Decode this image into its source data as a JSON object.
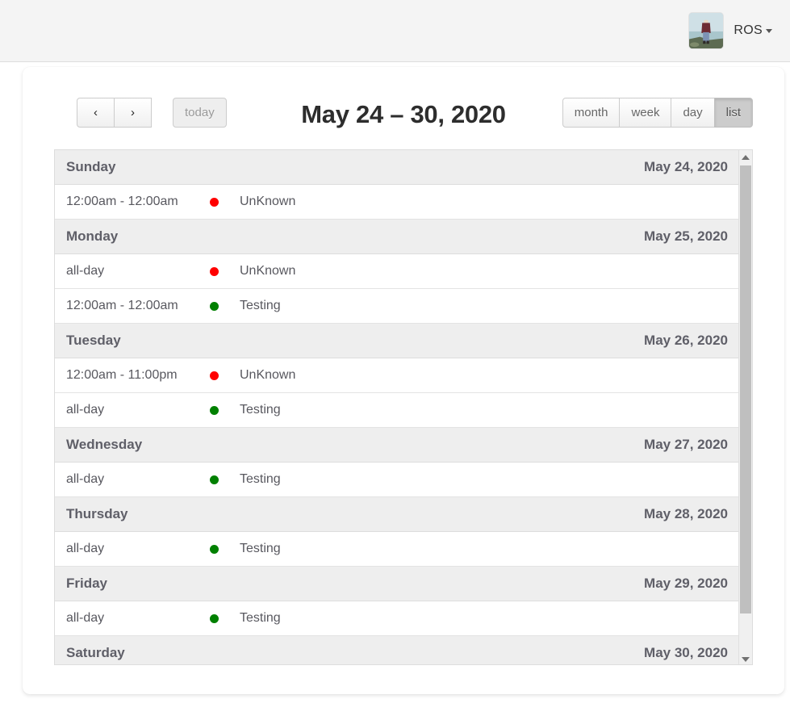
{
  "appbar": {
    "user_name": "ROS",
    "avatar_alt": "user-avatar",
    "caret": "chevron-down-icon"
  },
  "toolbar": {
    "prev_label": "‹",
    "next_label": "›",
    "today_label": "today",
    "title": "May 24 – 30, 2020",
    "views": [
      {
        "key": "month",
        "label": "month",
        "active": false
      },
      {
        "key": "week",
        "label": "week",
        "active": false
      },
      {
        "key": "day",
        "label": "day",
        "active": false
      },
      {
        "key": "list",
        "label": "list",
        "active": true
      }
    ]
  },
  "colors": {
    "event_unknown": "#ff0000",
    "event_testing": "#008000",
    "active_view_bg": "#cccccc",
    "day_header_bg": "#eeeeee",
    "page_bg": "#ffffff",
    "appbar_bg": "#f4f4f4"
  },
  "list": {
    "days": [
      {
        "dow": "Sunday",
        "date": "May 24, 2020",
        "events": [
          {
            "time": "12:00am - 12:00am",
            "title": "UnKnown",
            "color": "#ff0000"
          }
        ]
      },
      {
        "dow": "Monday",
        "date": "May 25, 2020",
        "events": [
          {
            "time": "all-day",
            "title": "UnKnown",
            "color": "#ff0000"
          },
          {
            "time": "12:00am - 12:00am",
            "title": "Testing",
            "color": "#008000"
          }
        ]
      },
      {
        "dow": "Tuesday",
        "date": "May 26, 2020",
        "events": [
          {
            "time": "12:00am - 11:00pm",
            "title": "UnKnown",
            "color": "#ff0000"
          },
          {
            "time": "all-day",
            "title": "Testing",
            "color": "#008000"
          }
        ]
      },
      {
        "dow": "Wednesday",
        "date": "May 27, 2020",
        "events": [
          {
            "time": "all-day",
            "title": "Testing",
            "color": "#008000"
          }
        ]
      },
      {
        "dow": "Thursday",
        "date": "May 28, 2020",
        "events": [
          {
            "time": "all-day",
            "title": "Testing",
            "color": "#008000"
          }
        ]
      },
      {
        "dow": "Friday",
        "date": "May 29, 2020",
        "events": [
          {
            "time": "all-day",
            "title": "Testing",
            "color": "#008000"
          }
        ]
      },
      {
        "dow": "Saturday",
        "date": "May 30, 2020",
        "events": []
      }
    ]
  },
  "scrollbar": {
    "up_icon": "triangle-up-icon",
    "down_icon": "triangle-down-icon"
  }
}
